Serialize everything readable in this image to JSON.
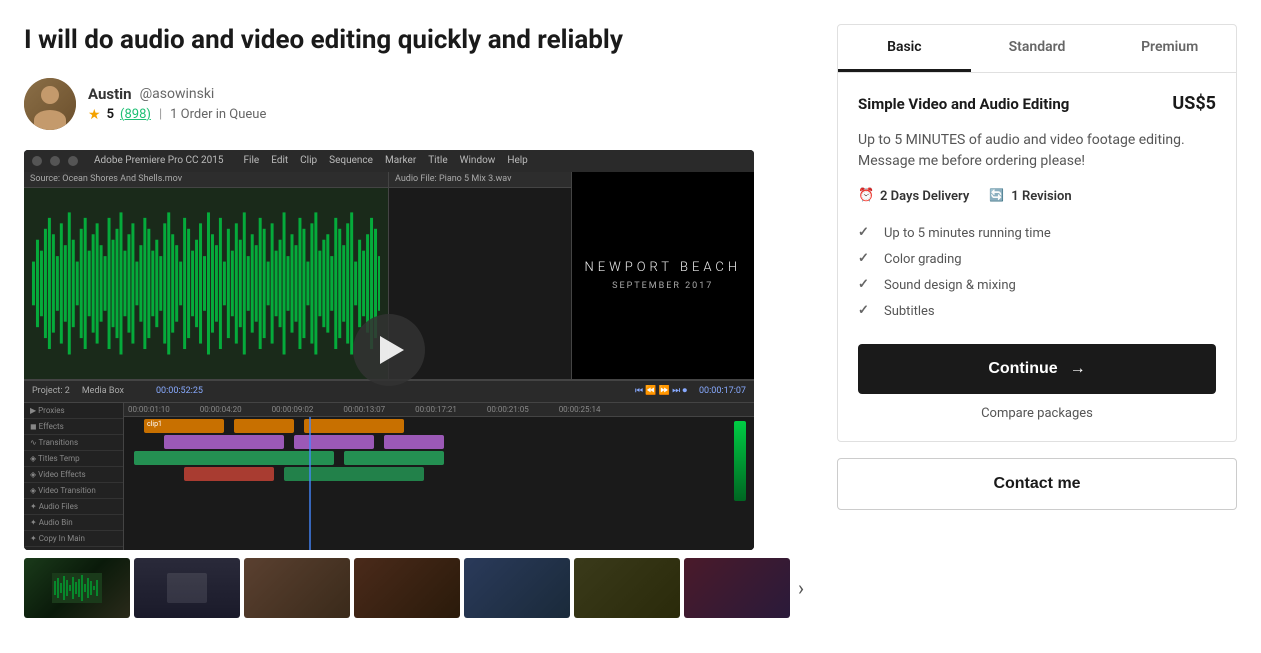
{
  "page": {
    "title": "I will do audio and video editing quickly and reliably"
  },
  "seller": {
    "name": "Austin",
    "handle": "@asowinski",
    "rating": "5",
    "rating_count": "898",
    "queue": "1 Order in Queue"
  },
  "video": {
    "location": "NEWPORT BEACH",
    "date": "SEPTEMBER 2017"
  },
  "thumbnails": [
    {
      "id": 1,
      "class": "thumb-1"
    },
    {
      "id": 2,
      "class": "thumb-2"
    },
    {
      "id": 3,
      "class": "thumb-3"
    },
    {
      "id": 4,
      "class": "thumb-4"
    },
    {
      "id": 5,
      "class": "thumb-5"
    },
    {
      "id": 6,
      "class": "thumb-6"
    },
    {
      "id": 7,
      "class": "thumb-7"
    }
  ],
  "package_tabs": [
    {
      "label": "Basic",
      "active": true
    },
    {
      "label": "Standard",
      "active": false
    },
    {
      "label": "Premium",
      "active": false
    }
  ],
  "package": {
    "name": "Simple Video and Audio Editing",
    "price": "US$5",
    "description": "Up to 5 MINUTES of audio and video footage editing. Message me before ordering please!",
    "delivery": "2 Days Delivery",
    "revisions": "1 Revision",
    "features": [
      "Up to 5 minutes running time",
      "Color grading",
      "Sound design & mixing",
      "Subtitles"
    ],
    "continue_label": "Continue",
    "continue_arrow": "→",
    "compare_label": "Compare packages",
    "contact_label": "Contact me"
  }
}
